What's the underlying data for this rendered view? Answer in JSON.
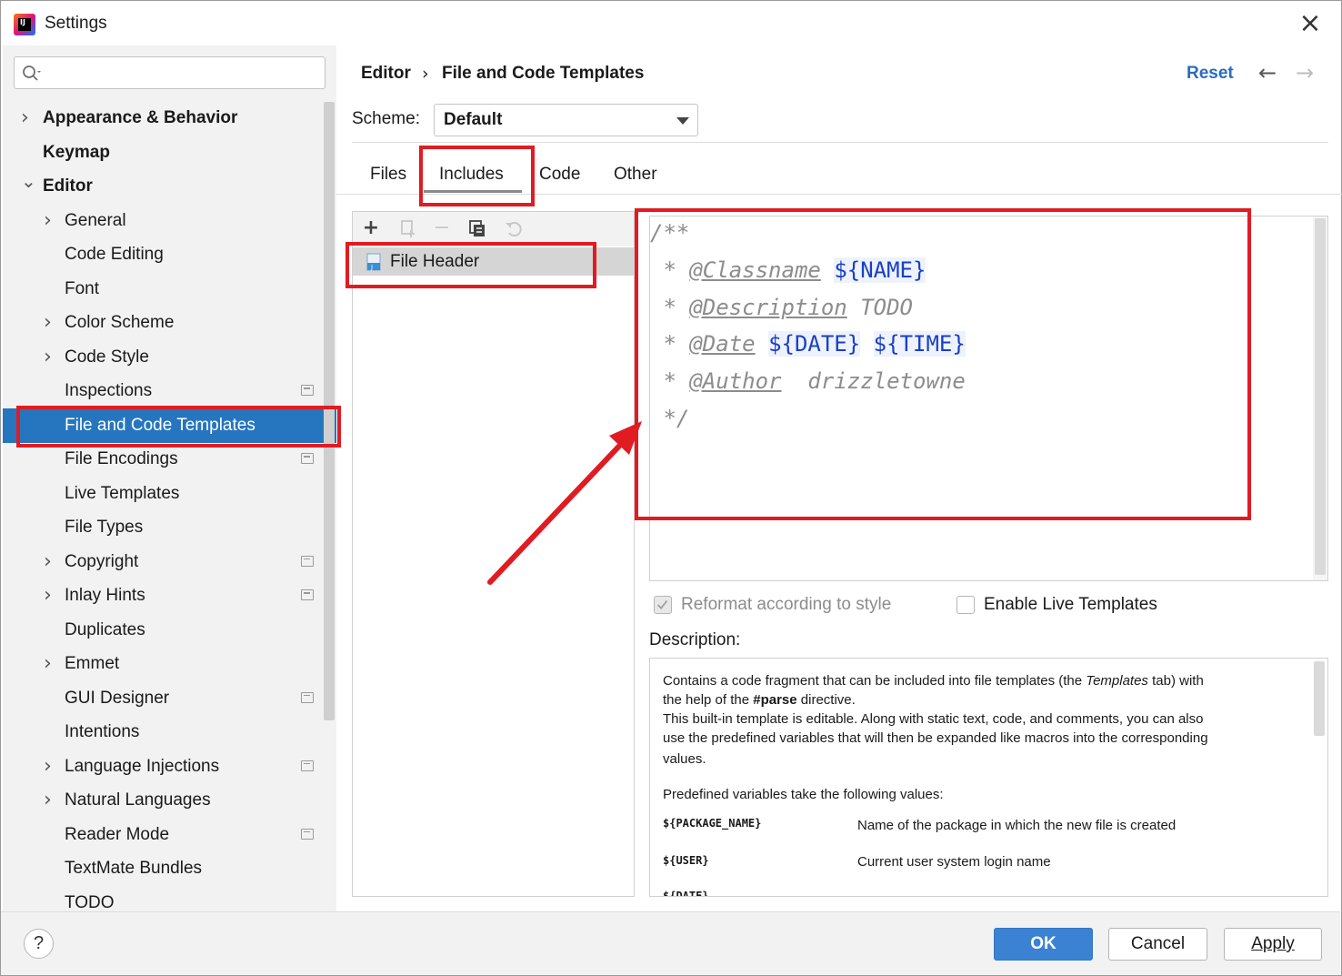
{
  "window": {
    "title": "Settings",
    "close_icon": "×"
  },
  "search": {
    "value": ""
  },
  "sidebar": {
    "items": [
      {
        "label": "Appearance & Behavior",
        "bold": true,
        "chevron": "right"
      },
      {
        "label": "Keymap",
        "bold": true
      },
      {
        "label": "Editor",
        "bold": true,
        "chevron": "down"
      },
      {
        "label": "General",
        "chevron": "right"
      },
      {
        "label": "Code Editing"
      },
      {
        "label": "Font"
      },
      {
        "label": "Color Scheme",
        "chevron": "right"
      },
      {
        "label": "Code Style",
        "chevron": "right"
      },
      {
        "label": "Inspections",
        "project_icon": true
      },
      {
        "label": "File and Code Templates",
        "selected": true
      },
      {
        "label": "File Encodings",
        "project_icon": true
      },
      {
        "label": "Live Templates"
      },
      {
        "label": "File Types"
      },
      {
        "label": "Copyright",
        "chevron": "right",
        "project_icon": true
      },
      {
        "label": "Inlay Hints",
        "chevron": "right",
        "project_icon": true
      },
      {
        "label": "Duplicates"
      },
      {
        "label": "Emmet",
        "chevron": "right"
      },
      {
        "label": "GUI Designer",
        "project_icon": true
      },
      {
        "label": "Intentions"
      },
      {
        "label": "Language Injections",
        "chevron": "right",
        "project_icon": true
      },
      {
        "label": "Natural Languages",
        "chevron": "right"
      },
      {
        "label": "Reader Mode",
        "project_icon": true
      },
      {
        "label": "TextMate Bundles"
      },
      {
        "label": "TODO"
      }
    ]
  },
  "header": {
    "breadcrumb": [
      "Editor",
      "File and Code Templates"
    ],
    "breadcrumb_sep": "›",
    "reset": "Reset",
    "back_icon": "←",
    "forward_icon": "→"
  },
  "scheme": {
    "label": "Scheme:",
    "value": "Default"
  },
  "tabs": [
    {
      "label": "Files"
    },
    {
      "label": "Includes",
      "active": true
    },
    {
      "label": "Code"
    },
    {
      "label": "Other"
    }
  ],
  "toolbar": {
    "add": "+",
    "remove": "−"
  },
  "templates_list": [
    {
      "label": "File Header",
      "selected": true
    }
  ],
  "editor": {
    "lines": [
      {
        "pre": "/**"
      },
      {
        "pre": " * ",
        "tag": "@Classname",
        "mid": " ",
        "vars": [
          "${NAME}"
        ]
      },
      {
        "pre": " * ",
        "tag": "@Description",
        "post": " TODO"
      },
      {
        "pre": " * ",
        "tag": "@Date",
        "mid": " ",
        "vars": [
          "${DATE}",
          "${TIME}"
        ]
      },
      {
        "pre": " * ",
        "tag": "@Author",
        "post": "  drizzletowne"
      },
      {
        "pre": " */"
      }
    ]
  },
  "options": {
    "reformat": {
      "label": "Reformat according to style",
      "checked": true,
      "enabled": false
    },
    "live_templates": {
      "label": "Enable Live Templates",
      "checked": false
    }
  },
  "description": {
    "label": "Description:",
    "lines": [
      "Contains a code fragment that can be included into file templates (the Templates tab) with",
      "the help of the #parse directive.",
      "This built-in template is editable. Along with static text, code, and comments, you can also",
      "use the predefined variables that will then be expanded like macros into the corresponding",
      "values."
    ],
    "predefined_heading": "Predefined variables take the following values:",
    "variables": [
      {
        "name": "${PACKAGE_NAME}",
        "desc": "Name of the package in which the new file is created"
      },
      {
        "name": "${USER}",
        "desc": "Current user system login name"
      },
      {
        "name": "${DATE}",
        "desc": ""
      }
    ]
  },
  "buttons": {
    "help": "?",
    "ok": "OK",
    "cancel": "Cancel",
    "apply": "Apply"
  },
  "colors": {
    "selection": "#2675bf",
    "annotation_red": "#e11b22",
    "link_blue": "#2a6bbf",
    "primary_button": "#3b82d3",
    "template_variable": "#1a3fc4"
  }
}
